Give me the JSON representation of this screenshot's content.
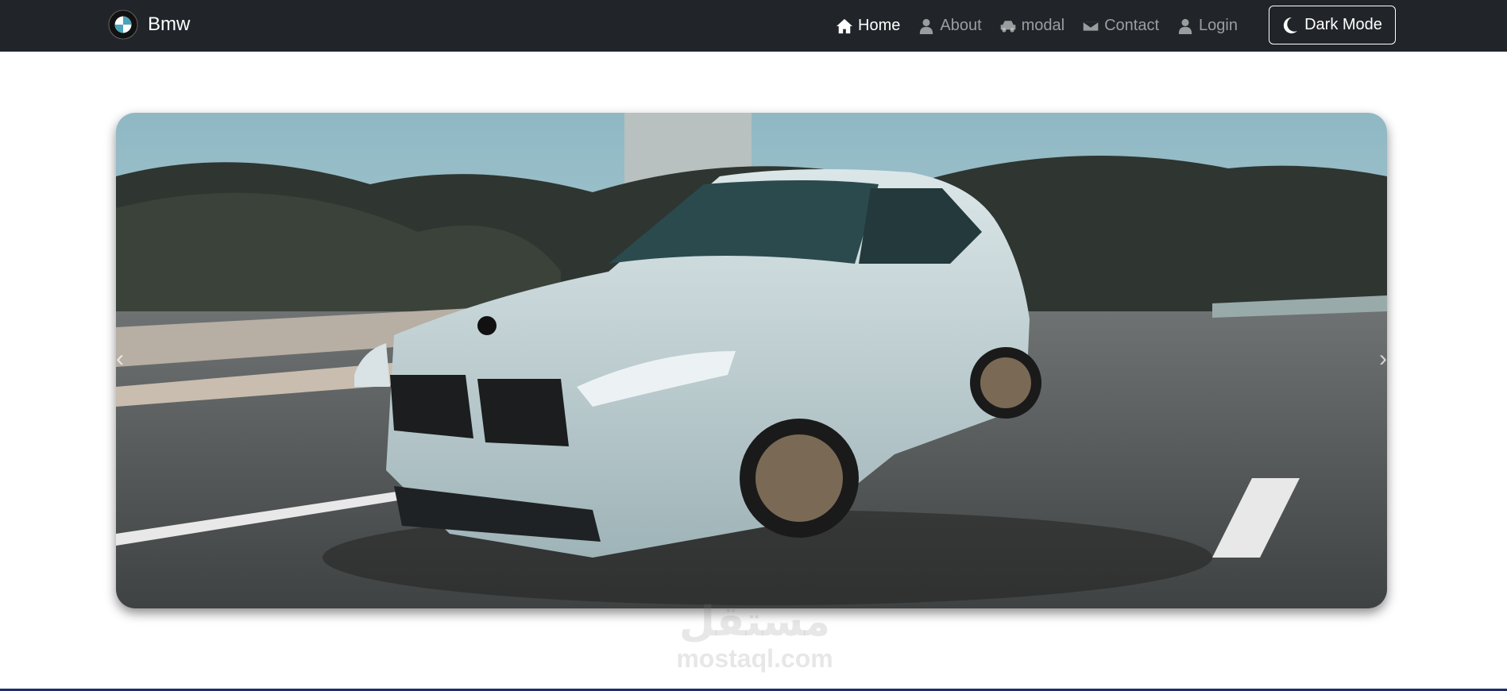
{
  "navbar": {
    "brand": "Bmw",
    "items": [
      {
        "label": "Home",
        "icon": "home-icon",
        "active": true
      },
      {
        "label": "About",
        "icon": "user-icon"
      },
      {
        "label": "modal",
        "icon": "car-icon"
      },
      {
        "label": "Contact",
        "icon": "envelope-icon"
      },
      {
        "label": "Login",
        "icon": "user-icon"
      }
    ],
    "dark_mode_label": "Dark Mode"
  },
  "carousel": {
    "prev": "‹",
    "next": "›"
  },
  "watermark": {
    "arabic": "مستقل",
    "latin": "mostaql.com"
  },
  "colors": {
    "navbar": "#212529",
    "accent": "#ffffff"
  }
}
